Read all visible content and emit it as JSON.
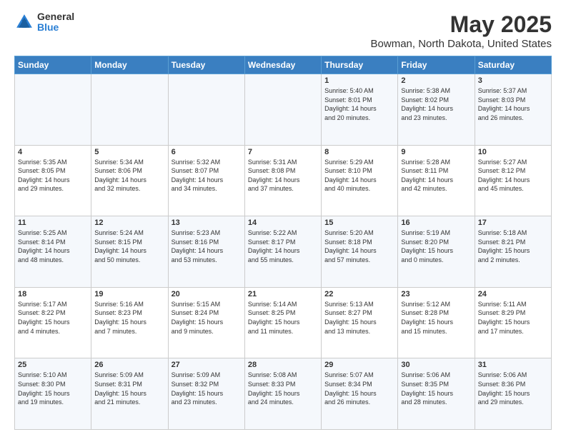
{
  "logo": {
    "general": "General",
    "blue": "Blue"
  },
  "header": {
    "title": "May 2025",
    "subtitle": "Bowman, North Dakota, United States"
  },
  "weekdays": [
    "Sunday",
    "Monday",
    "Tuesday",
    "Wednesday",
    "Thursday",
    "Friday",
    "Saturday"
  ],
  "weeks": [
    [
      {
        "day": "",
        "info": ""
      },
      {
        "day": "",
        "info": ""
      },
      {
        "day": "",
        "info": ""
      },
      {
        "day": "",
        "info": ""
      },
      {
        "day": "1",
        "info": "Sunrise: 5:40 AM\nSunset: 8:01 PM\nDaylight: 14 hours\nand 20 minutes."
      },
      {
        "day": "2",
        "info": "Sunrise: 5:38 AM\nSunset: 8:02 PM\nDaylight: 14 hours\nand 23 minutes."
      },
      {
        "day": "3",
        "info": "Sunrise: 5:37 AM\nSunset: 8:03 PM\nDaylight: 14 hours\nand 26 minutes."
      }
    ],
    [
      {
        "day": "4",
        "info": "Sunrise: 5:35 AM\nSunset: 8:05 PM\nDaylight: 14 hours\nand 29 minutes."
      },
      {
        "day": "5",
        "info": "Sunrise: 5:34 AM\nSunset: 8:06 PM\nDaylight: 14 hours\nand 32 minutes."
      },
      {
        "day": "6",
        "info": "Sunrise: 5:32 AM\nSunset: 8:07 PM\nDaylight: 14 hours\nand 34 minutes."
      },
      {
        "day": "7",
        "info": "Sunrise: 5:31 AM\nSunset: 8:08 PM\nDaylight: 14 hours\nand 37 minutes."
      },
      {
        "day": "8",
        "info": "Sunrise: 5:29 AM\nSunset: 8:10 PM\nDaylight: 14 hours\nand 40 minutes."
      },
      {
        "day": "9",
        "info": "Sunrise: 5:28 AM\nSunset: 8:11 PM\nDaylight: 14 hours\nand 42 minutes."
      },
      {
        "day": "10",
        "info": "Sunrise: 5:27 AM\nSunset: 8:12 PM\nDaylight: 14 hours\nand 45 minutes."
      }
    ],
    [
      {
        "day": "11",
        "info": "Sunrise: 5:25 AM\nSunset: 8:14 PM\nDaylight: 14 hours\nand 48 minutes."
      },
      {
        "day": "12",
        "info": "Sunrise: 5:24 AM\nSunset: 8:15 PM\nDaylight: 14 hours\nand 50 minutes."
      },
      {
        "day": "13",
        "info": "Sunrise: 5:23 AM\nSunset: 8:16 PM\nDaylight: 14 hours\nand 53 minutes."
      },
      {
        "day": "14",
        "info": "Sunrise: 5:22 AM\nSunset: 8:17 PM\nDaylight: 14 hours\nand 55 minutes."
      },
      {
        "day": "15",
        "info": "Sunrise: 5:20 AM\nSunset: 8:18 PM\nDaylight: 14 hours\nand 57 minutes."
      },
      {
        "day": "16",
        "info": "Sunrise: 5:19 AM\nSunset: 8:20 PM\nDaylight: 15 hours\nand 0 minutes."
      },
      {
        "day": "17",
        "info": "Sunrise: 5:18 AM\nSunset: 8:21 PM\nDaylight: 15 hours\nand 2 minutes."
      }
    ],
    [
      {
        "day": "18",
        "info": "Sunrise: 5:17 AM\nSunset: 8:22 PM\nDaylight: 15 hours\nand 4 minutes."
      },
      {
        "day": "19",
        "info": "Sunrise: 5:16 AM\nSunset: 8:23 PM\nDaylight: 15 hours\nand 7 minutes."
      },
      {
        "day": "20",
        "info": "Sunrise: 5:15 AM\nSunset: 8:24 PM\nDaylight: 15 hours\nand 9 minutes."
      },
      {
        "day": "21",
        "info": "Sunrise: 5:14 AM\nSunset: 8:25 PM\nDaylight: 15 hours\nand 11 minutes."
      },
      {
        "day": "22",
        "info": "Sunrise: 5:13 AM\nSunset: 8:27 PM\nDaylight: 15 hours\nand 13 minutes."
      },
      {
        "day": "23",
        "info": "Sunrise: 5:12 AM\nSunset: 8:28 PM\nDaylight: 15 hours\nand 15 minutes."
      },
      {
        "day": "24",
        "info": "Sunrise: 5:11 AM\nSunset: 8:29 PM\nDaylight: 15 hours\nand 17 minutes."
      }
    ],
    [
      {
        "day": "25",
        "info": "Sunrise: 5:10 AM\nSunset: 8:30 PM\nDaylight: 15 hours\nand 19 minutes."
      },
      {
        "day": "26",
        "info": "Sunrise: 5:09 AM\nSunset: 8:31 PM\nDaylight: 15 hours\nand 21 minutes."
      },
      {
        "day": "27",
        "info": "Sunrise: 5:09 AM\nSunset: 8:32 PM\nDaylight: 15 hours\nand 23 minutes."
      },
      {
        "day": "28",
        "info": "Sunrise: 5:08 AM\nSunset: 8:33 PM\nDaylight: 15 hours\nand 24 minutes."
      },
      {
        "day": "29",
        "info": "Sunrise: 5:07 AM\nSunset: 8:34 PM\nDaylight: 15 hours\nand 26 minutes."
      },
      {
        "day": "30",
        "info": "Sunrise: 5:06 AM\nSunset: 8:35 PM\nDaylight: 15 hours\nand 28 minutes."
      },
      {
        "day": "31",
        "info": "Sunrise: 5:06 AM\nSunset: 8:36 PM\nDaylight: 15 hours\nand 29 minutes."
      }
    ]
  ]
}
